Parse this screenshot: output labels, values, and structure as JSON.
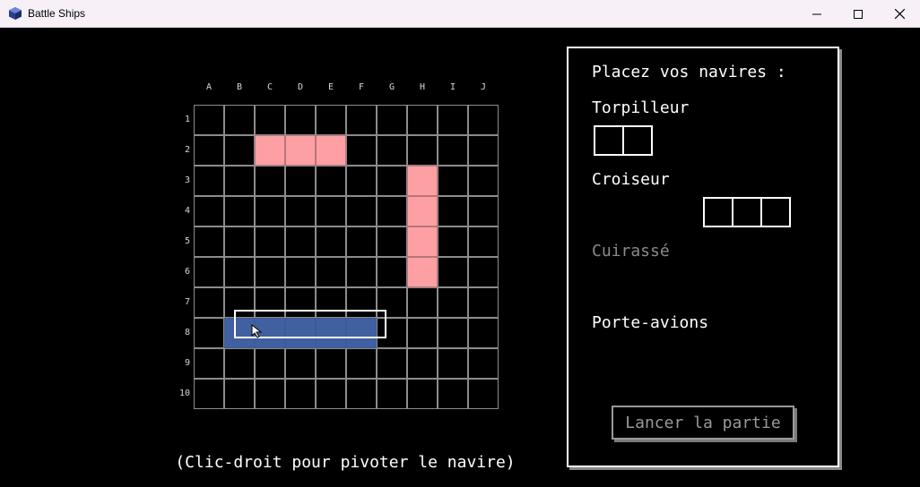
{
  "window": {
    "title": "Battle Ships",
    "icon": "cube-icon"
  },
  "board": {
    "columns": [
      "A",
      "B",
      "C",
      "D",
      "E",
      "F",
      "G",
      "H",
      "I",
      "J"
    ],
    "rows": [
      "1",
      "2",
      "3",
      "4",
      "5",
      "6",
      "7",
      "8",
      "9",
      "10"
    ],
    "placed_ships": [
      {
        "color": "#fea0a3",
        "cells": [
          "C2",
          "D2",
          "E2"
        ]
      },
      {
        "color": "#fea0a3",
        "cells": [
          "H3",
          "H4",
          "H5",
          "H6"
        ]
      }
    ],
    "hover_ship": {
      "color": "#41609f",
      "cells": [
        "B8",
        "C8",
        "D8",
        "E8",
        "F8"
      ]
    }
  },
  "hint": "(Clic-droit pour pivoter le navire)",
  "panel": {
    "title": "Placez vos navires :",
    "ships": [
      {
        "name": "Torpilleur",
        "size": 2,
        "state": "available"
      },
      {
        "name": "Croiseur",
        "size": 3,
        "state": "available"
      },
      {
        "name": "Cuirassé",
        "size": 4,
        "state": "placed"
      },
      {
        "name": "Porte-avions",
        "size": 5,
        "state": "selected"
      }
    ],
    "launch_label": "Lancer la partie"
  }
}
